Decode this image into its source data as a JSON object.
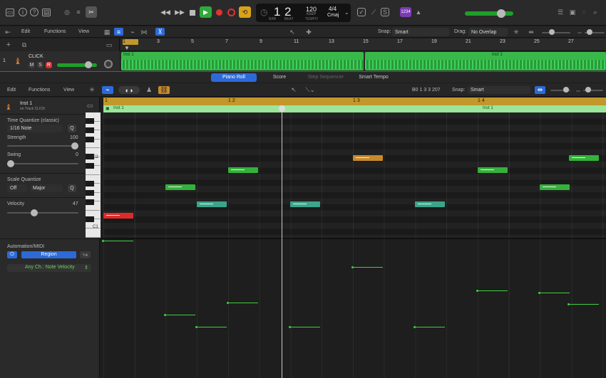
{
  "transport": {
    "bar": "1",
    "beat": "2",
    "bar_label": "BAR",
    "beat_label": "BEAT",
    "tempo": "120",
    "tempo_sub": "KEEP",
    "tempo_label": "TEMPO",
    "signature": "4/4",
    "key": "Cmaj",
    "count_in": "1234"
  },
  "tracks_header": {
    "edit": "Edit",
    "functions": "Functions",
    "view": "View",
    "snap_label": "Snap:",
    "snap_value": "Smart",
    "drag_label": "Drag:",
    "drag_value": "No Overlap"
  },
  "track": {
    "number": "1",
    "name": "CLICK",
    "m": "M",
    "s": "S",
    "r": "R"
  },
  "arrange_ruler": [
    "1",
    "3",
    "5",
    "7",
    "9",
    "11",
    "13",
    "15",
    "17",
    "19",
    "21",
    "23",
    "25",
    "27"
  ],
  "arrange_regions": {
    "region1": "Inst 1",
    "region2": "Inst 1"
  },
  "editor_tabs": [
    "Piano Roll",
    "Score",
    "Step Sequencer",
    "Smart Tempo"
  ],
  "editor_toolbar": {
    "edit": "Edit",
    "functions": "Functions",
    "view": "View",
    "position": "B0  1 3 3 207",
    "snap_label": "Snap:",
    "snap_value": "Smart"
  },
  "region_info": {
    "name": "Inst 1",
    "track": "on Track CLICK"
  },
  "inspector": {
    "tq_title": "Time Quantize (classic)",
    "tq_value": "1/16 Note",
    "q_btn": "Q",
    "strength_label": "Strength",
    "strength_value": "100",
    "swing_label": "Swing",
    "swing_value": "0",
    "sq_title": "Scale Quantize",
    "sq_off": "Off",
    "sq_major": "Major",
    "sq_q": "Q",
    "velocity_label": "Velocity",
    "velocity_value": "47",
    "automation_title": "Automation/MIDI",
    "region_btn": "Region",
    "param": "Any Ch.: Note Velocity"
  },
  "editor_ruler": [
    "1",
    "1 2",
    "1 3",
    "1 4"
  ],
  "editor_region_labels": [
    "Inst 1",
    "Inst 1"
  ],
  "piano_labels": [
    "C2",
    "C1"
  ],
  "colors": {
    "accent": "#2d6ad8",
    "region_green": "#34b13a",
    "note_teal": "#3aa58a",
    "note_orange": "#c8892c",
    "note_red": "#e02a2a"
  }
}
